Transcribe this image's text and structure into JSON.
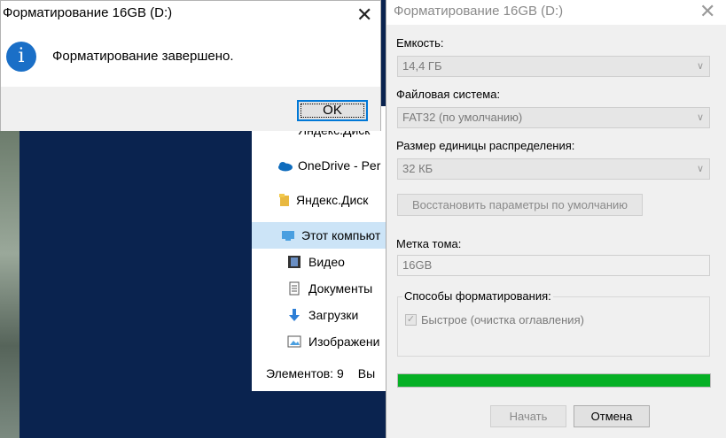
{
  "message_dialog": {
    "title": "Форматирование 16GB (D:)",
    "message": "Форматирование завершено.",
    "ok_label": "OK",
    "close_symbol": "✕",
    "icon": "info-icon"
  },
  "explorer": {
    "nav_items": [
      {
        "label": "Яндекс.Диск",
        "icon": "yandex-disk-icon",
        "partial": true
      },
      {
        "label": "OneDrive - Per",
        "icon": "onedrive-icon"
      },
      {
        "label": "Яндекс.Диск",
        "icon": "yandex-disk-folder-icon"
      },
      {
        "label": "Этот компьют",
        "icon": "this-pc-icon",
        "selected": true
      },
      {
        "label": "Видео",
        "icon": "video-icon"
      },
      {
        "label": "Документы",
        "icon": "documents-icon"
      },
      {
        "label": "Загрузки",
        "icon": "downloads-icon"
      },
      {
        "label": "Изображени",
        "icon": "pictures-icon"
      }
    ],
    "status": "Элементов: 9",
    "status_extra": "Вы"
  },
  "format_dialog": {
    "title": "Форматирование 16GB (D:)",
    "close_symbol": "✕",
    "capacity_label": "Емкость:",
    "capacity_value": "14,4 ГБ",
    "fs_label": "Файловая система:",
    "fs_value": "FAT32 (по умолчанию)",
    "alloc_label": "Размер единицы распределения:",
    "alloc_value": "32 КБ",
    "restore_label": "Восстановить параметры по умолчанию",
    "volume_label": "Метка тома:",
    "volume_value": "16GB",
    "format_options_label": "Способы форматирования:",
    "quick_format_label": "Быстрое (очистка оглавления)",
    "quick_format_checked": true,
    "progress": 1.0,
    "progress_color": "#06b025",
    "start_label": "Начать",
    "cancel_label": "Отмена"
  }
}
